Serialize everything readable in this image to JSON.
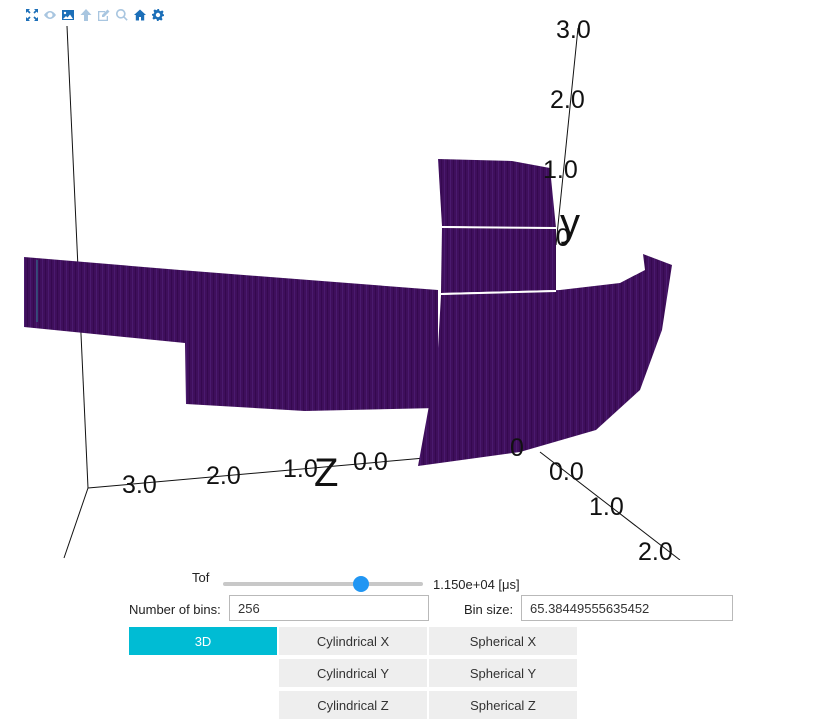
{
  "toolbar": {
    "icons": [
      "expand-icon",
      "eye-icon",
      "image-icon",
      "arrow-up-icon",
      "edit-icon",
      "zoom-icon",
      "home-icon",
      "gear-icon"
    ],
    "active_color": "#1c6fb8",
    "disabled_color": "#a9c6e0"
  },
  "scene": {
    "detector_color": "#3f0f5c",
    "y_axis": {
      "name": "y",
      "ticks": [
        "3.0",
        "2.0",
        "1.0",
        "0"
      ]
    },
    "z_axis": {
      "name": "Z",
      "ticks": [
        "3.0",
        "2.0",
        "1.0",
        "0.0"
      ]
    },
    "x_axis": {
      "ticks": [
        "0.0",
        "1.0",
        "2.0",
        "0"
      ]
    }
  },
  "tof": {
    "label": "Tof",
    "slider_position": 0.69,
    "value_text": "1.150e+04 [μs]"
  },
  "bins": {
    "number_label": "Number of bins:",
    "number_value": "256",
    "size_label": "Bin size:",
    "size_value": "65.38449555635452"
  },
  "projections": {
    "accent_color": "#00bcd4",
    "buttons": {
      "three_d": "3D",
      "cyl_x": "Cylindrical X",
      "cyl_y": "Cylindrical Y",
      "cyl_z": "Cylindrical Z",
      "sph_x": "Spherical X",
      "sph_y": "Spherical Y",
      "sph_z": "Spherical Z"
    },
    "selected": "3D"
  }
}
